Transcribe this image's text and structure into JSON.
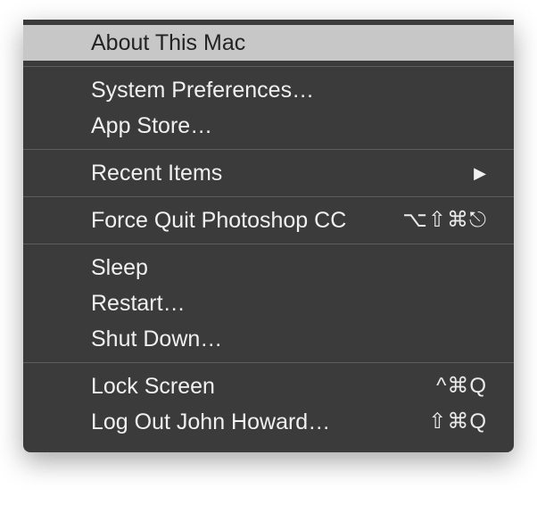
{
  "menu": {
    "groups": [
      {
        "items": [
          {
            "label": "About This Mac",
            "highlighted": true
          }
        ]
      },
      {
        "items": [
          {
            "label": "System Preferences…"
          },
          {
            "label": "App Store…"
          }
        ]
      },
      {
        "items": [
          {
            "label": "Recent Items",
            "submenu": true
          }
        ]
      },
      {
        "items": [
          {
            "label": "Force Quit Photoshop CC",
            "shortcut": "⌥⇧⌘⎋"
          }
        ]
      },
      {
        "items": [
          {
            "label": "Sleep"
          },
          {
            "label": "Restart…"
          },
          {
            "label": "Shut Down…"
          }
        ]
      },
      {
        "items": [
          {
            "label": "Lock Screen",
            "shortcut": "^⌘Q"
          },
          {
            "label": "Log Out John Howard…",
            "shortcut": "⇧⌘Q"
          }
        ]
      }
    ]
  }
}
